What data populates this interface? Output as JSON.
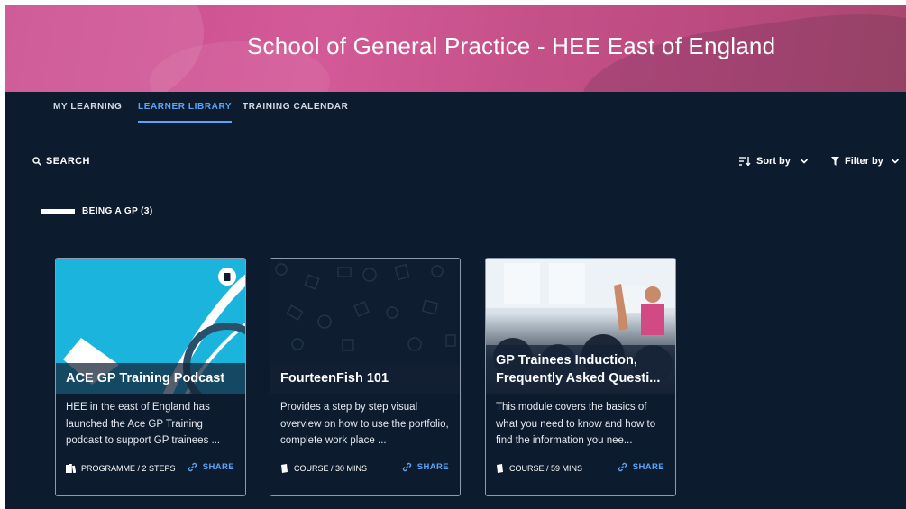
{
  "banner": {
    "title": "School of General Practice - HEE East of England"
  },
  "nav": {
    "tabs": [
      {
        "label": "MY LEARNING"
      },
      {
        "label": "LEARNER LIBRARY",
        "active": true
      },
      {
        "label": "TRAINING CALENDAR"
      }
    ]
  },
  "toolbar": {
    "search_label": "SEARCH",
    "sort_label": "Sort by",
    "filter_label": "Filter by"
  },
  "section": {
    "title": "BEING A GP (3)"
  },
  "cards": [
    {
      "title": "ACE GP Training Podcast",
      "description": "HEE in the east of England has launched the Ace GP Training podcast to support GP trainees ...",
      "meta": "PROGRAMME / 2 STEPS",
      "share": "SHARE",
      "type_icon": "books-icon"
    },
    {
      "title": "FourteenFish 101",
      "description": "Provides a step by step visual overview on how to use the portfolio, complete work place ...",
      "meta": "COURSE / 30 MINS",
      "share": "SHARE",
      "type_icon": "book-icon"
    },
    {
      "title": "GP Trainees Induction, Frequently Asked Questi...",
      "description": "This module covers the basics of what you need to know and how to find the information you nee...",
      "meta": "COURSE / 59 MINS",
      "share": "SHARE",
      "type_icon": "book-icon"
    }
  ],
  "colors": {
    "background": "#0d1b2e",
    "accent": "#5ba4f5",
    "banner": "#c94a8e",
    "podcast_thumb": "#1ab4dc"
  }
}
